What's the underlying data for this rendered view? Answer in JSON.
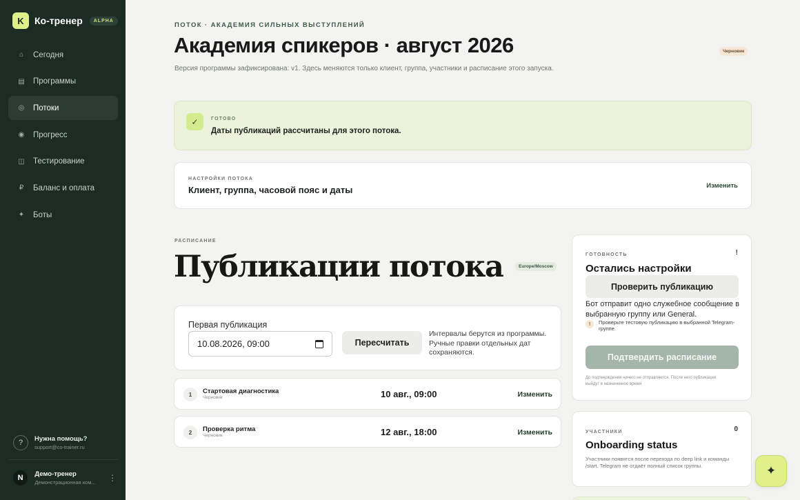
{
  "brand": {
    "logo_letter": "K",
    "name": "Ко-тренер",
    "badge": "ALPHA"
  },
  "sidebar": {
    "items": [
      {
        "label": "Сегодня",
        "icon": "home-icon",
        "glyph": "⌂"
      },
      {
        "label": "Программы",
        "icon": "list-icon",
        "glyph": "▤"
      },
      {
        "label": "Потоки",
        "icon": "stream-icon",
        "glyph": "◎"
      },
      {
        "label": "Прогресс",
        "icon": "progress-icon",
        "glyph": "◉"
      },
      {
        "label": "Тестирование",
        "icon": "test-icon",
        "glyph": "◫"
      },
      {
        "label": "Баланс и оплата",
        "icon": "ruble-icon",
        "glyph": "₽"
      },
      {
        "label": "Боты",
        "icon": "sparkle-icon",
        "glyph": "✦"
      }
    ],
    "active_index": 2,
    "help": {
      "icon": "?",
      "title": "Нужна помощь?",
      "email": "support@co-trainer.ru"
    },
    "user": {
      "initial": "N",
      "name": "Демо-тренер",
      "subtitle": "Демонстрационная ком...",
      "more": "⋮"
    }
  },
  "header": {
    "eyebrow": "ПОТОК · АКАДЕМИЯ СИЛЬНЫХ ВЫСТУПЛЕНИЙ",
    "title": "Академия спикеров · август 2026",
    "status": "Черновик",
    "subtitle": "Версия программы зафиксирована: v1. Здесь меняются только клиент, группа, участники и расписание этого запуска."
  },
  "success": {
    "check": "✓",
    "label": "ГОТОВО",
    "text": "Даты публикаций рассчитаны для этого потока."
  },
  "settings": {
    "label": "НАСТРОЙКИ ПОТОКА",
    "title": "Клиент, группа, часовой пояс и даты",
    "edit": "Изменить"
  },
  "schedule": {
    "label": "РАСПИСАНИЕ",
    "title": "Публикации потока",
    "timezone": "Europe/Moscow",
    "first_label": "Первая публикация",
    "first_value": "10.08.2026, 09:00",
    "recalc": "Пересчитать",
    "note": "Интервалы берутся из программы. Ручные правки отдельных дат сохраняются.",
    "rows": [
      {
        "num": "1",
        "title": "Стартовая диагностика",
        "status": "Черновик",
        "date": "10 авг., 09:00",
        "edit": "Изменить"
      },
      {
        "num": "2",
        "title": "Проверка ритма",
        "status": "Черновик",
        "date": "12 авг., 18:00",
        "edit": "Изменить"
      }
    ]
  },
  "readiness": {
    "label": "ГОТОВНОСТЬ",
    "indicator": "!",
    "title": "Остались настройки",
    "check_button": "Проверить публикацию",
    "description": "Бот отправит одно служебное сообщение в выбранную группу или General.",
    "warning_icon": "!",
    "warning": "Проверьте тестовую публикацию в выбранной Telegram-группе.",
    "confirm_button": "Подтвердить расписание",
    "footnote": "До подтверждения ничего не отправляется. После него публикации выйдут в назначенное время"
  },
  "members": {
    "label": "УЧАСТНИКИ",
    "count": "0",
    "title": "Onboarding status",
    "description": "Участники появятся после перехода по deep link и команды /start. Telegram не отдаёт полный список группы."
  },
  "fab": {
    "glyph": "✦"
  }
}
